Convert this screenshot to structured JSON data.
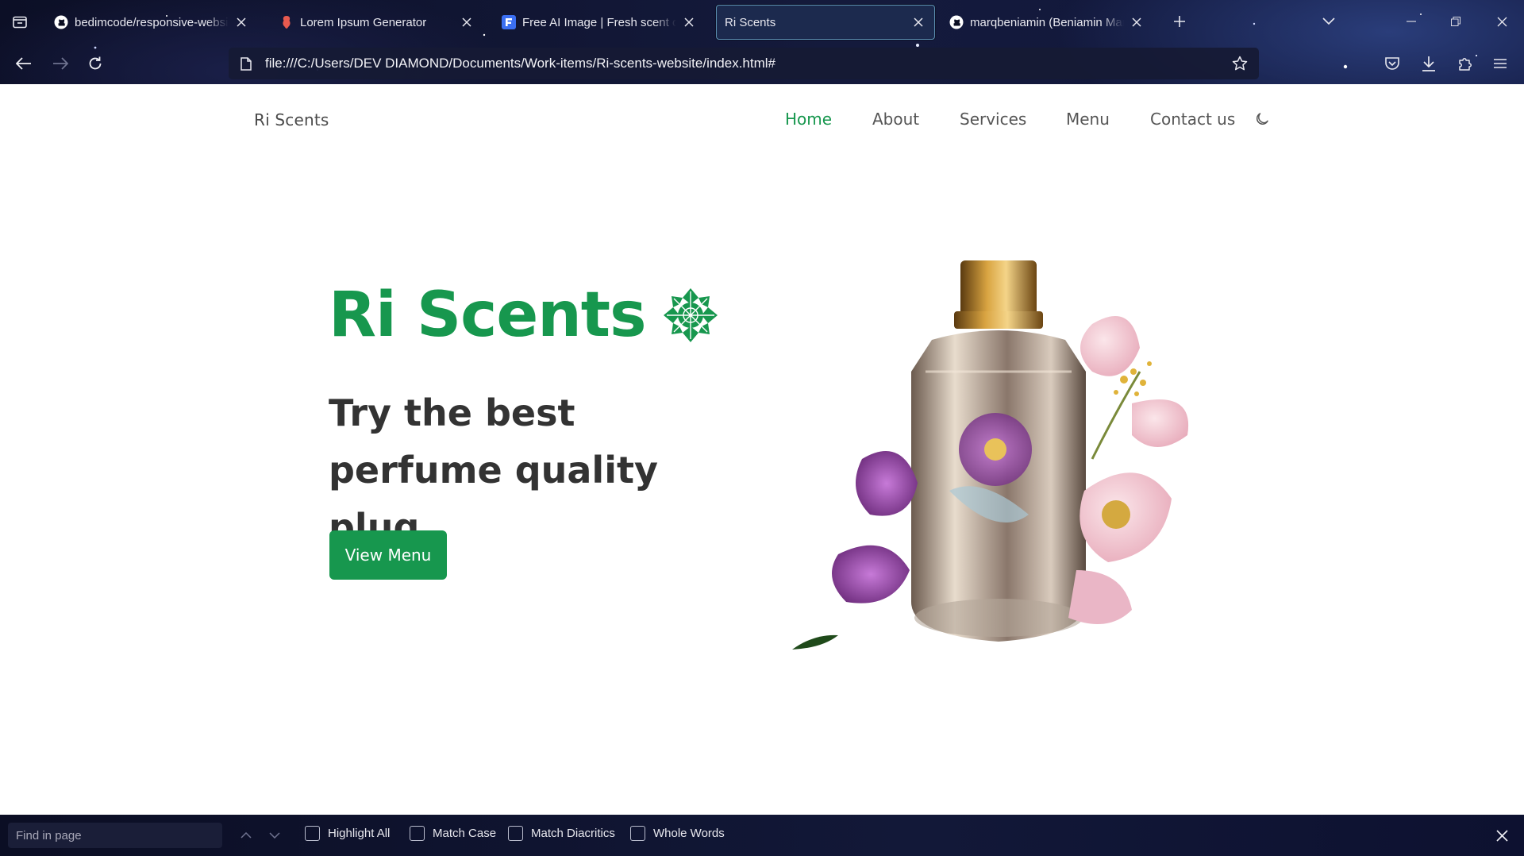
{
  "browser": {
    "tabs": [
      {
        "title": "bedimcode/responsive-website",
        "favicon": "github-icon"
      },
      {
        "title": "Lorem Ipsum Generator",
        "favicon": "lorem-ipsum-icon"
      },
      {
        "title": "Free AI Image | Fresh scent of p",
        "favicon": "freepik-icon"
      },
      {
        "title": "Ri Scents",
        "favicon": "none",
        "active": true
      },
      {
        "title": "marqbeniamin (Beniamin Marc",
        "favicon": "github-icon"
      }
    ],
    "url": "file:///C:/Users/DEV DIAMOND/Documents/Work-items/Ri-scents-website/index.html#"
  },
  "site": {
    "logo": "Ri Scents",
    "nav": [
      {
        "label": "Home",
        "active": true
      },
      {
        "label": "About"
      },
      {
        "label": "Services"
      },
      {
        "label": "Menu"
      },
      {
        "label": "Contact us"
      }
    ],
    "hero": {
      "title": "Ri Scents",
      "subtitle": "Try the best perfume quality plug.",
      "cta_label": "View Menu"
    },
    "accent_color": "#17974e"
  },
  "findbar": {
    "placeholder": "Find in page",
    "options": [
      "Highlight All",
      "Match Case",
      "Match Diacritics",
      "Whole Words"
    ]
  }
}
